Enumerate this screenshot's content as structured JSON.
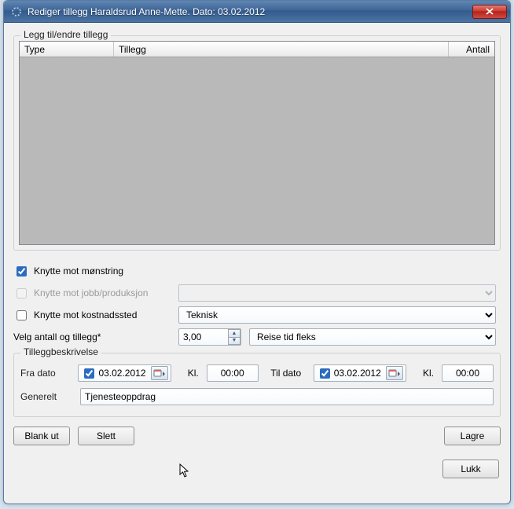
{
  "window": {
    "title": "Rediger tillegg Haraldsrud Anne-Mette. Dato: 03.02.2012"
  },
  "topGroup": {
    "legend": "Legg til/endre tillegg",
    "columns": {
      "type": "Type",
      "tillegg": "Tillegg",
      "antall": "Antall"
    }
  },
  "form": {
    "monstrering": {
      "label": "Knytte mot mønstring",
      "checked": true
    },
    "jobb": {
      "label": "Knytte mot jobb/produksjon",
      "checked": false,
      "enabled": false,
      "selected": ""
    },
    "kostnad": {
      "label": "Knytte mot kostnadssted",
      "checked": false,
      "selected": "Teknisk"
    },
    "velg": {
      "label": "Velg antall og tillegg*",
      "amount": "3,00",
      "type": "Reise tid fleks"
    }
  },
  "desc": {
    "legend": "Tilleggbeskrivelse",
    "fraDato": {
      "label": "Fra dato",
      "checked": true,
      "date": "03.02.2012"
    },
    "klLabel": "Kl.",
    "fraTime": "00:00",
    "tilDato": {
      "label": "Til dato",
      "checked": true,
      "date": "03.02.2012"
    },
    "tilTime": "00:00",
    "generelt": {
      "label": "Generelt",
      "value": "Tjenesteoppdrag"
    }
  },
  "buttons": {
    "blank": "Blank ut",
    "slett": "Slett",
    "lagre": "Lagre",
    "lukk": "Lukk"
  }
}
